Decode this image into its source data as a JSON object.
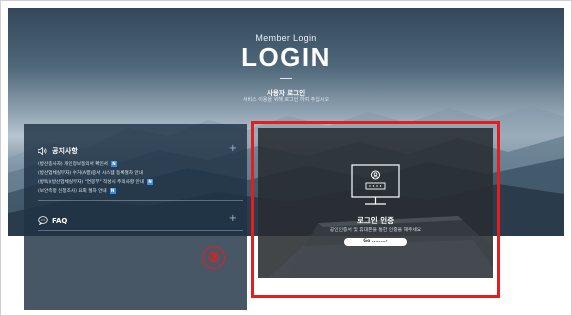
{
  "header": {
    "small_title": "Member Login",
    "big_title": "LOGIN",
    "subtitle": "사용자 로그인",
    "subtitle2": "서비스 이용을 위해 로그인 하여 주십시오"
  },
  "notices": {
    "title": "공지사항",
    "plus": "+",
    "items": [
      {
        "text": "(방산종사자) 개인정보동의서 확인서",
        "badge": "N"
      },
      {
        "text": "(방산업체실무자) 수거(A행)중서 시스템 등록절차 안내",
        "badge": ""
      },
      {
        "text": "(방독)(방산업체실무자) \"연봉부\" 작성시 주의사항 안내",
        "badge": "N"
      },
      {
        "text": "(보안측정 신청조사) 요회 절차 안내",
        "badge": "N"
      }
    ]
  },
  "faq": {
    "label": "FAQ",
    "plus": "+"
  },
  "step_marker": "③",
  "login": {
    "title": "로그인 인증",
    "description": "공인인증서 및 휴대폰을 통한 인증을 해주세요",
    "button_label": "Go ........›"
  },
  "colors": {
    "highlight_red": "#e41e1e",
    "badge_blue": "#3a8ed8"
  }
}
